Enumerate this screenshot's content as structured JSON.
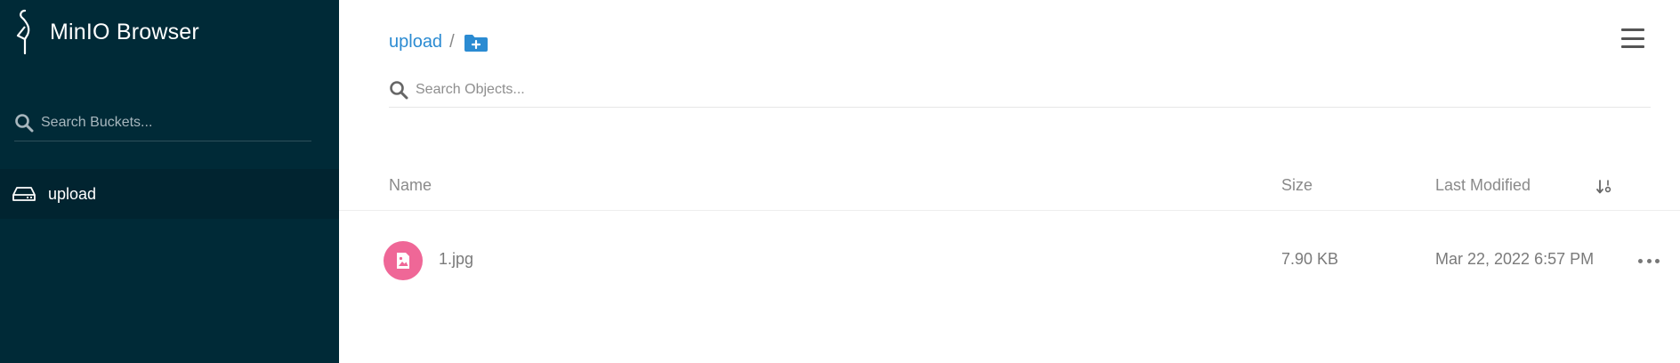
{
  "app": {
    "name": "MinIO Browser"
  },
  "sidebar": {
    "search_placeholder": "Search Buckets...",
    "buckets": [
      {
        "label": "upload",
        "icon": "drive-icon",
        "active": true
      }
    ]
  },
  "header": {
    "breadcrumb": [
      {
        "label": "upload"
      }
    ],
    "separator": "/",
    "add_folder_icon": "folder-plus-icon",
    "menu_icon": "hamburger-icon"
  },
  "search": {
    "placeholder": "Search Objects..."
  },
  "table": {
    "columns": [
      "Name",
      "Size",
      "Last Modified"
    ],
    "sort_icon": "sort-icon",
    "rows": [
      {
        "icon": "image-file-icon",
        "name": "1.jpg",
        "size": "7.90 KB",
        "modified": "Mar 22, 2022 6:57 PM"
      }
    ]
  },
  "colors": {
    "sidebar_bg": "#002a37",
    "accent": "#2b8bd2",
    "file_icon_bg": "#ef6797"
  }
}
